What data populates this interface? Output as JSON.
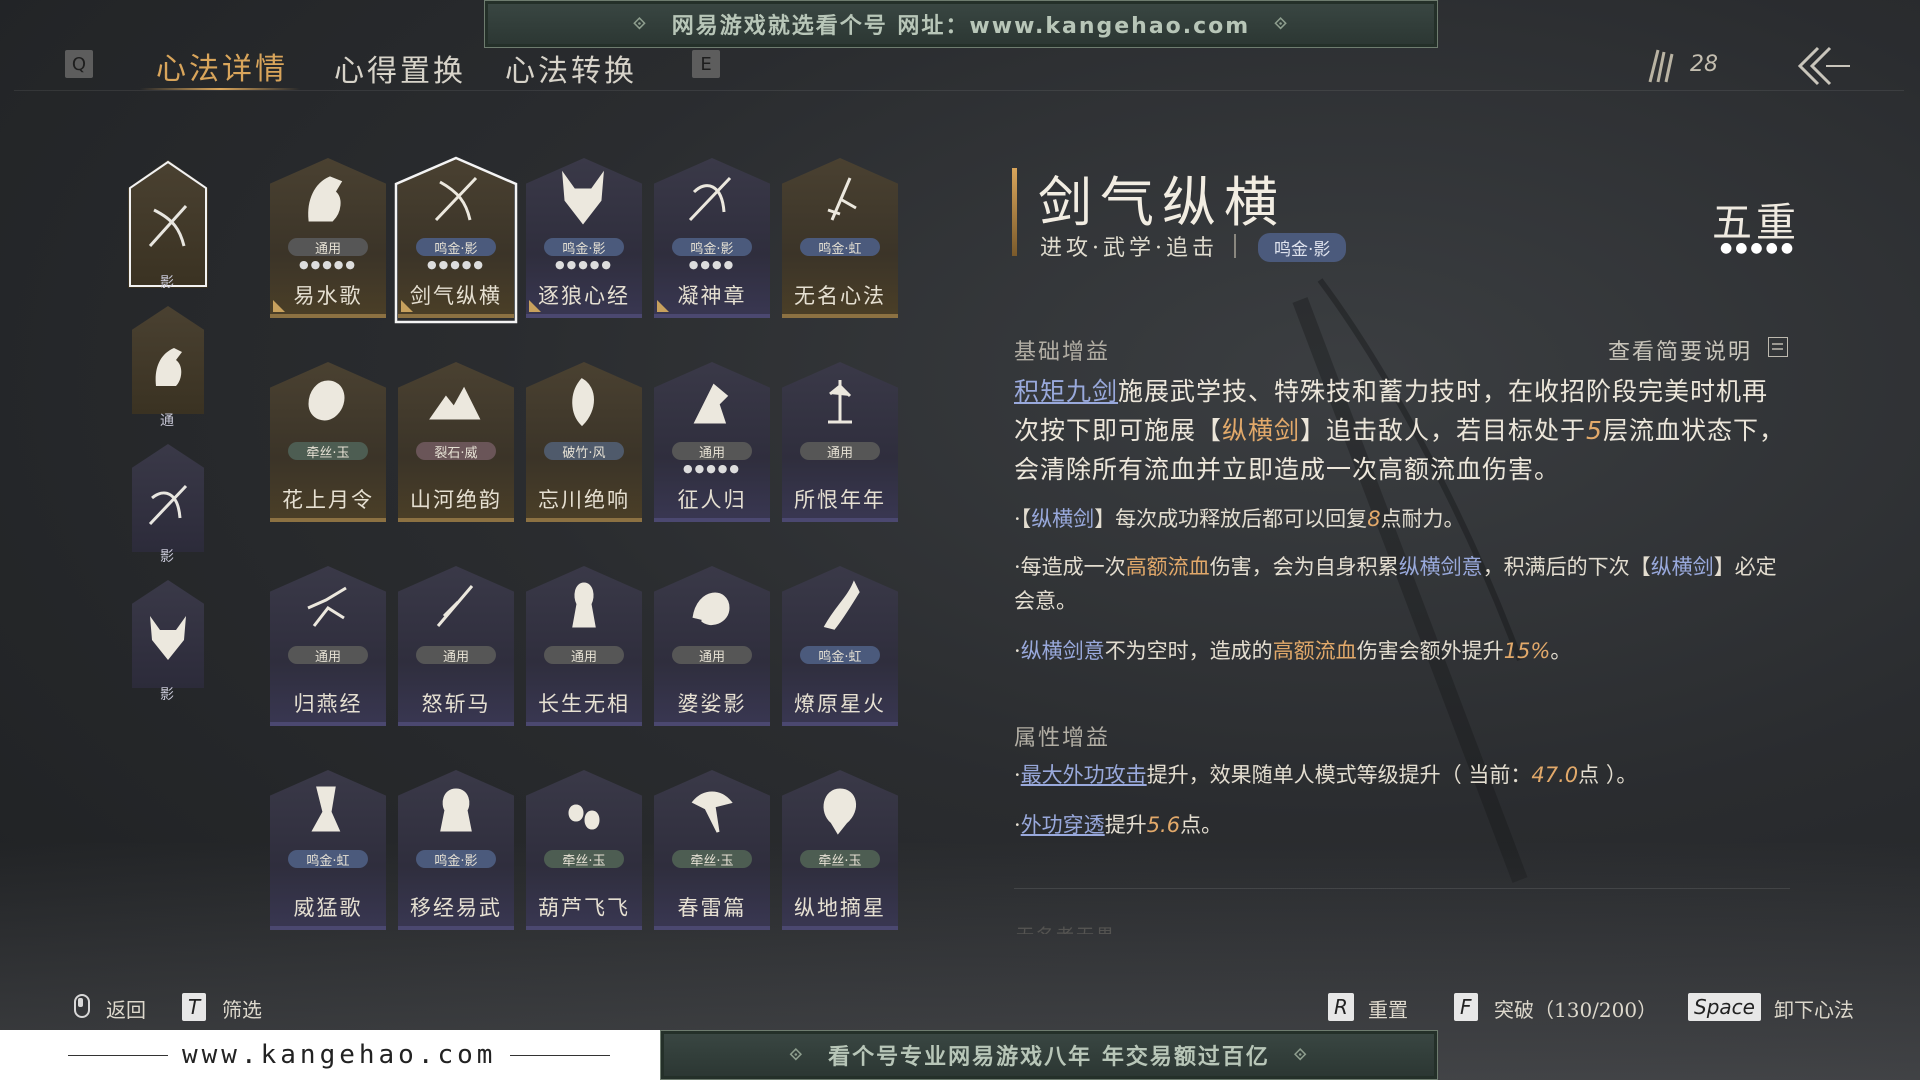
{
  "banners": {
    "top": "网易游戏就选看个号   网址：www.kangehao.com",
    "bottom": "看个号专业网易游戏八年   年交易额过百亿",
    "site": "www.kangehao.com",
    "orn": "⟐"
  },
  "tabs": {
    "prev_key": "Q",
    "next_key": "E",
    "items": [
      {
        "label": "心法详情"
      },
      {
        "label": "心得置换"
      },
      {
        "label": "心法转换"
      }
    ]
  },
  "currency": {
    "count": "28"
  },
  "side_slots": [
    {
      "label": "影"
    },
    {
      "label": "通"
    },
    {
      "label": "影"
    },
    {
      "label": "影"
    }
  ],
  "cards": [
    {
      "name": "易水歌",
      "tag": "通用",
      "dots": "●●●●●",
      "check": true
    },
    {
      "name": "剑气纵横",
      "tag": "鸣金·影",
      "dots": "●●●●●",
      "check": true
    },
    {
      "name": "逐狼心经",
      "tag": "鸣金·影",
      "dots": "●●●●●",
      "check": true
    },
    {
      "name": "凝神章",
      "tag": "鸣金·影",
      "dots": "●●●●",
      "check": true
    },
    {
      "name": "无名心法",
      "tag": "鸣金·虹",
      "dots": "",
      "check": false
    },
    {
      "name": "花上月令",
      "tag": "牵丝·玉",
      "dots": "",
      "check": false
    },
    {
      "name": "山河绝韵",
      "tag": "裂石·威",
      "dots": "",
      "check": false
    },
    {
      "name": "忘川绝响",
      "tag": "破竹·风",
      "dots": "",
      "check": false
    },
    {
      "name": "征人归",
      "tag": "通用",
      "dots": "●●●●●",
      "check": false
    },
    {
      "name": "所恨年年",
      "tag": "通用",
      "dots": "",
      "check": false
    },
    {
      "name": "归燕经",
      "tag": "通用",
      "dots": "",
      "check": false
    },
    {
      "name": "怒斩马",
      "tag": "通用",
      "dots": "",
      "check": false
    },
    {
      "name": "长生无相",
      "tag": "通用",
      "dots": "",
      "check": false
    },
    {
      "name": "婆娑影",
      "tag": "通用",
      "dots": "",
      "check": false
    },
    {
      "name": "燎原星火",
      "tag": "鸣金·虹",
      "dots": "",
      "check": false
    },
    {
      "name": "威猛歌",
      "tag": "鸣金·虹",
      "dots": "",
      "check": false
    },
    {
      "name": "移经易武",
      "tag": "鸣金·影",
      "dots": "",
      "check": false
    },
    {
      "name": "葫芦飞飞",
      "tag": "牵丝·玉",
      "dots": "",
      "check": false
    },
    {
      "name": "春雷篇",
      "tag": "牵丝·玉",
      "dots": "",
      "check": false
    },
    {
      "name": "纵地摘星",
      "tag": "牵丝·玉",
      "dots": "",
      "check": false
    }
  ],
  "detail": {
    "title": "剑气纵横",
    "subtitle": "进攻·武学·追击",
    "pill": "鸣金·影",
    "rank": "五重",
    "rank_dots": "●●●●●",
    "base_header": "基础增益",
    "view_brief": "查看简要说明",
    "p1": {
      "a": "积矩九剑",
      "b": "施展武学技、特殊技和蓄力技时，在收招阶段完美时机再次按下即可施展【",
      "c": "纵横剑",
      "d": "】追击敌人，若目标处于",
      "e": "5",
      "f": "层流血状态下，会清除所有流血并立即造成一次高额流血伤害。"
    },
    "b1": {
      "a": "·【",
      "b": "纵横剑",
      "c": "】每次成功释放后都可以回复",
      "d": "8",
      "e": "点耐力。"
    },
    "b2": {
      "a": "·每造成一次",
      "b": "高额流血",
      "c": "伤害，会为自身积累",
      "d": "纵横剑意",
      "e": "，积满后的下次【",
      "f": "纵横剑",
      "g": "】必定会意。"
    },
    "b3": {
      "a": "·",
      "b": "纵横剑意",
      "c": "不为空时，造成的",
      "d": "高额流血",
      "e": "伤害会额外提升",
      "f": "15%",
      "g": "。"
    },
    "attr_header": "属性增益",
    "a1": {
      "a": "·",
      "b": "最大外功攻击",
      "c": "提升，效果随单人模式等级提升（ 当前：",
      "d": "47.0",
      "e": "点 ）。"
    },
    "a2": {
      "a": "·",
      "b": "外功穿透",
      "c": "提升",
      "d": "5.6",
      "e": "点。"
    },
    "faded": "无名者无畏"
  },
  "footer": {
    "back": "返回",
    "filter_key": "T",
    "filter": "筛选",
    "reset_key": "R",
    "reset": "重置",
    "break_key": "F",
    "break": "突破（130/200）",
    "unload_key": "Space",
    "unload": "卸下心法"
  }
}
